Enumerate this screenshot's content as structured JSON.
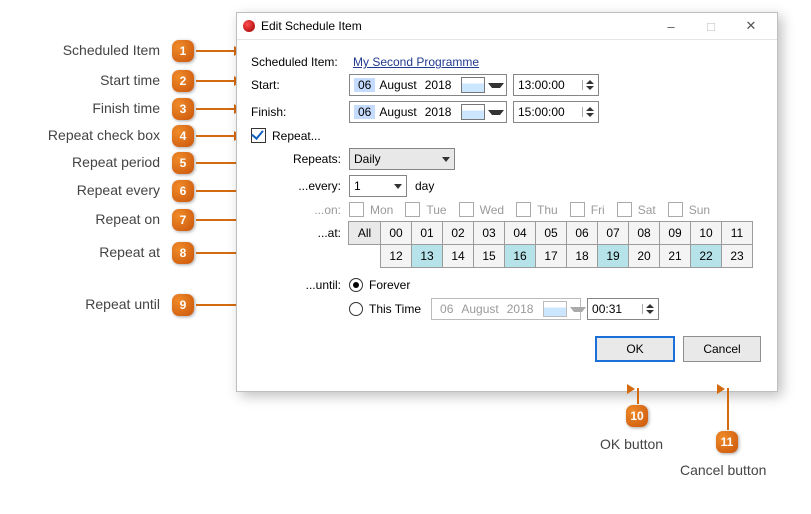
{
  "callouts": {
    "c1": "Scheduled Item",
    "c2": "Start time",
    "c3": "Finish time",
    "c4": "Repeat check box",
    "c5": "Repeat period",
    "c6": "Repeat every",
    "c7": "Repeat on",
    "c8": "Repeat at",
    "c9": "Repeat until",
    "c10": "OK button",
    "c11": "Cancel button",
    "n1": "1",
    "n2": "2",
    "n3": "3",
    "n4": "4",
    "n5": "5",
    "n6": "6",
    "n7": "7",
    "n8": "8",
    "n9": "9",
    "n10": "10",
    "n11": "11"
  },
  "window": {
    "title": "Edit Schedule Item",
    "labels": {
      "scheduled_item": "Scheduled Item:",
      "start": "Start:",
      "finish": "Finish:",
      "repeat": "Repeat...",
      "repeats": "Repeats:",
      "every": "...every:",
      "every_unit": "day",
      "on": "...on:",
      "at": "...at:",
      "all": "All",
      "until": "...until:",
      "forever": "Forever",
      "this_time": "This Time",
      "ok": "OK",
      "cancel": "Cancel"
    },
    "scheduled_item_value": "My Second Programme",
    "start_date": {
      "day": "06",
      "month": "August",
      "year": "2018"
    },
    "start_time": "13:00:00",
    "finish_date": {
      "day": "06",
      "month": "August",
      "year": "2018"
    },
    "finish_time": "15:00:00",
    "repeat_checked": true,
    "repeats_value": "Daily",
    "every_value": "1",
    "days": {
      "mon": "Mon",
      "tue": "Tue",
      "wed": "Wed",
      "thu": "Thu",
      "fri": "Fri",
      "sat": "Sat",
      "sun": "Sun"
    },
    "hours_top": [
      "00",
      "01",
      "02",
      "03",
      "04",
      "05",
      "06",
      "07",
      "08",
      "09",
      "10",
      "11"
    ],
    "hours_bottom": [
      "12",
      "13",
      "14",
      "15",
      "16",
      "17",
      "18",
      "19",
      "20",
      "21",
      "22",
      "23"
    ],
    "hours_selected": [
      "13",
      "16",
      "19",
      "22"
    ],
    "until_forever": true,
    "until_date": {
      "day": "06",
      "month": "August",
      "year": "2018"
    },
    "until_time": "00:31"
  }
}
